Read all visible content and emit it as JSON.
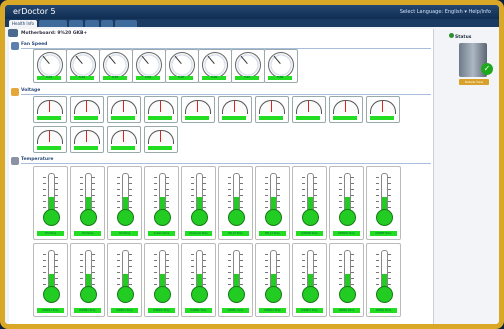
{
  "window": {
    "title": "erDoctor 5",
    "top_right": "Select Language: English  ▾  Help/Info"
  },
  "tabs": [
    {
      "label": "Health Info",
      "active": true
    },
    {
      "label": "",
      "active": false
    },
    {
      "label": "",
      "active": false
    },
    {
      "label": "",
      "active": false
    },
    {
      "label": "",
      "active": false
    },
    {
      "label": "",
      "active": false
    }
  ],
  "motherboard": {
    "label": "Motherboard: 9%20 GKB+"
  },
  "fan_speed": {
    "title": "Fan Speed",
    "gauges": [
      {
        "label": "FAN1"
      },
      {
        "label": "FAN2"
      },
      {
        "label": "FAN3"
      },
      {
        "label": "FAN4"
      },
      {
        "label": "FAN5"
      },
      {
        "label": "FAN6"
      },
      {
        "label": "FAN7"
      },
      {
        "label": "FAN8"
      }
    ]
  },
  "voltage": {
    "title": "Voltage",
    "meters": [
      {
        "label": ""
      },
      {
        "label": ""
      },
      {
        "label": ""
      },
      {
        "label": ""
      },
      {
        "label": ""
      },
      {
        "label": ""
      },
      {
        "label": ""
      },
      {
        "label": ""
      },
      {
        "label": ""
      },
      {
        "label": ""
      },
      {
        "label": ""
      },
      {
        "label": ""
      },
      {
        "label": ""
      },
      {
        "label": ""
      }
    ]
  },
  "temperature": {
    "title": "Temperature",
    "thermometers": [
      {
        "value": "",
        "label": "CPU Temp"
      },
      {
        "value": "",
        "label": "CPU Temp"
      },
      {
        "value": "",
        "label": "CPU Temp"
      },
      {
        "value": "",
        "label": "System Temp"
      },
      {
        "value": "",
        "label": "Peripheral Temp"
      },
      {
        "value": "",
        "label": "MB_10 Temp"
      },
      {
        "value": "",
        "label": "MB_11 Temp"
      },
      {
        "value": "",
        "label": "DIMMAB Temp"
      },
      {
        "value": "",
        "label": "DIMMCD Temp"
      },
      {
        "value": "",
        "label": "DIMMEF Temp"
      },
      {
        "value": "",
        "label": "DIMMA1 Temp"
      },
      {
        "value": "",
        "label": "DIMMB1 Temp"
      },
      {
        "value": "",
        "label": "DIMMC1 Temp"
      },
      {
        "value": "",
        "label": "DIMMD1 Temp"
      },
      {
        "value": "",
        "label": "DIMME1 Temp"
      },
      {
        "value": "",
        "label": "DIMMF1 Temp"
      },
      {
        "value": "",
        "label": "DIMMG1 Temp"
      },
      {
        "value": "",
        "label": "DIMMH1 Temp"
      },
      {
        "value": "",
        "label": "DIMMI1 Temp"
      },
      {
        "value": "",
        "label": "DIMMJ1 Temp"
      }
    ]
  },
  "status_panel": {
    "title": "Status",
    "button": "Details View"
  },
  "colors": {
    "frame": "#d9a826",
    "ok_green": "#22dd22",
    "titlebar": "#1b3b63"
  }
}
